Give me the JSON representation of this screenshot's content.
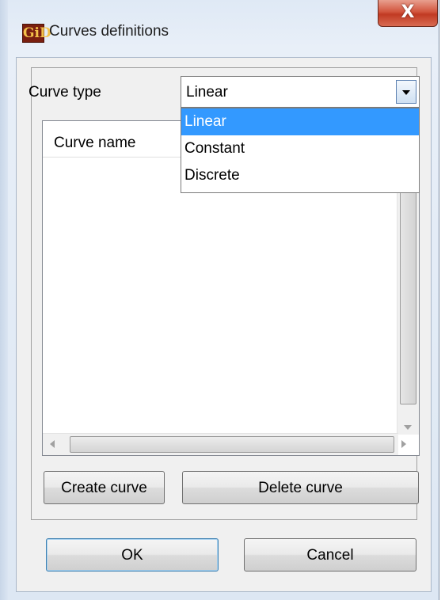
{
  "window": {
    "title": "Curves definitions",
    "app_icon_text": "GiD",
    "close_symbol": "X"
  },
  "form": {
    "curve_type_label": "Curve type",
    "curve_type_value": "Linear",
    "curve_type_options": [
      "Linear",
      "Constant",
      "Discrete"
    ],
    "selected_option_index": 0
  },
  "list": {
    "column_header": "Curve name",
    "rows": []
  },
  "buttons": {
    "create_curve": "Create curve",
    "delete_curve": "Delete curve",
    "ok": "OK",
    "cancel": "Cancel"
  },
  "colors": {
    "selection": "#3399ff",
    "close_button": "#c13a23",
    "app_icon_bg": "#7a1f10",
    "app_icon_fg": "#f3c24a"
  }
}
